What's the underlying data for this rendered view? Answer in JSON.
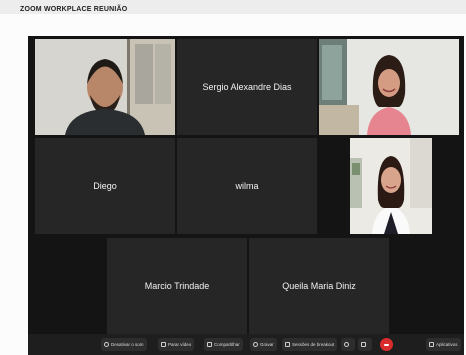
{
  "topbar": {
    "text": "ZOOM  WORKPLACE REUNIÃO"
  },
  "participants": [
    {
      "name": "",
      "video": true
    },
    {
      "name": "Sergio Alexandre Dias",
      "video": false
    },
    {
      "name": "",
      "video": true
    },
    {
      "name": "Diego",
      "video": false
    },
    {
      "name": "wilma",
      "video": false
    },
    {
      "name": "",
      "video": true
    },
    {
      "name": "Marcio Trindade",
      "video": false
    },
    {
      "name": "Queila Maria Diniz",
      "video": false
    }
  ],
  "controls": {
    "mute": "Desativar o som",
    "video": "Parar vídeo",
    "share": "Compartilhar",
    "record": "Gravar",
    "breakout": "Sessões de breakout",
    "apps": "Aplicativos"
  }
}
